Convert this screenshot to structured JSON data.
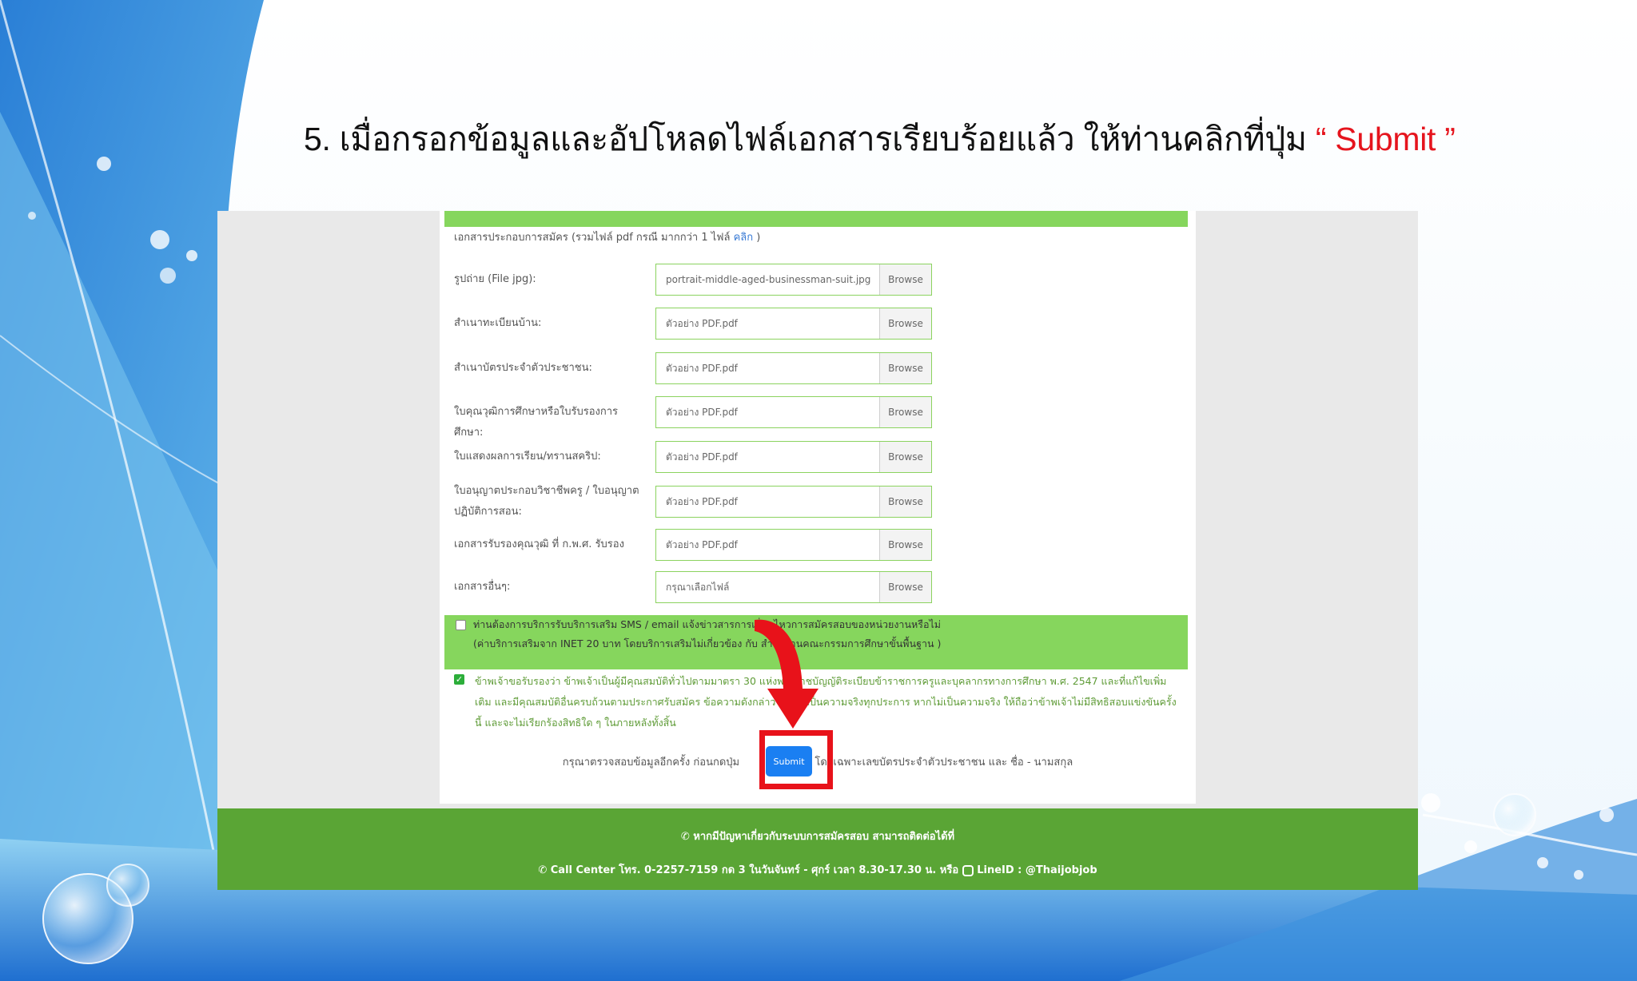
{
  "slide": {
    "title_prefix": "5. เมื่อกรอกข้อมูลและอัปโหลดไฟล์เอกสารเรียบร้อยแล้ว ให้ท่านคลิกที่ปุ่ม",
    "title_highlight": "“ Submit ”",
    "highlight_color": "#e5141d"
  },
  "form": {
    "intro_text": "เอกสารประกอบการสมัคร (รวมไฟล์ pdf กรณี มากกว่า 1 ไฟล์",
    "intro_link": "คลิก",
    "intro_close": ")",
    "browse_label": "Browse",
    "rows": [
      {
        "label": "รูปถ่าย (File jpg):",
        "file": "portrait-middle-aged-businessman-suit.jpg"
      },
      {
        "label": "สำเนาทะเบียนบ้าน:",
        "file": "ตัวอย่าง PDF.pdf"
      },
      {
        "label": "สำเนาบัตรประจำตัวประชาชน:",
        "file": "ตัวอย่าง PDF.pdf"
      },
      {
        "label": "ใบคุณวุฒิการศึกษาหรือใบรับรองการศึกษา:",
        "file": "ตัวอย่าง PDF.pdf"
      },
      {
        "label": "ใบแสดงผลการเรียน/ทรานสคริป:",
        "file": "ตัวอย่าง PDF.pdf"
      },
      {
        "label": "ใบอนุญาตประกอบวิชาชีพครู / ใบอนุญาตปฏิบัติการสอน:",
        "file": "ตัวอย่าง PDF.pdf"
      },
      {
        "label": "เอกสารรับรองคุณวุฒิ ที่ ก.พ.ศ. รับรอง",
        "file": "ตัวอย่าง PDF.pdf"
      },
      {
        "label": "เอกสารอื่นๆ:",
        "file": "กรุณาเลือกไฟล์"
      }
    ],
    "sms_line1": "ท่านต้องการบริการรับบริการเสริม SMS / email แจ้งข่าวสารการเลื่อนไหวการสมัครสอบของหน่วยงานหรือไม่",
    "sms_line2": "(ค่าบริการเสริมจาก INET 20 บาท โดยบริการเสริมไม่เกี่ยวข้อง กับ สำนักงานคณะกรรมการศึกษาขั้นพื้นฐาน )",
    "consent_text": "ข้าพเจ้าขอรับรองว่า ข้าพเจ้าเป็นผู้มีคุณสมบัติทั่วไปตามมาตรา 30 แห่งพระราชบัญญัติระเบียบข้าราชการครูและบุคลากรทางการศึกษา พ.ศ. 2547 และที่แก้ไขเพิ่มเติม และมีคุณสมบัติอื่นครบถ้วนตามประกาศรับสมัคร ข้อความดังกล่าวข้างต้นเป็นความจริงทุกประการ หากไม่เป็นความจริง ให้ถือว่าข้าพเจ้าไม่มีสิทธิสอบแข่งขันครั้งนี้ และจะไม่เรียกร้องสิทธิใด ๆ ในภายหลังทั้งสิ้น",
    "consent_checked": true,
    "sms_checked": false,
    "submit_note_before": "กรุณาตรวจสอบข้อมูลอีกครั้ง ก่อนกดปุ่ม",
    "submit_note_after": "โดยเฉพาะเลขบัตรประจำตัวประชาชน และ ชื่อ - นามสกุล",
    "submit_label": "Submit"
  },
  "footer": {
    "line1": "หากมีปัญหาเกี่ยวกับระบบการสมัครสอบ สามารถติดต่อได้ที่",
    "line2": "Call Center โทร. 0-2257-7159 กด 3 ในวันจันทร์ - ศุกร์ เวลา 8.30-17.30 น. หรือ",
    "line_id": "LineID : @Thaijobjob"
  },
  "colors": {
    "green_bar": "#86d65d",
    "footer_green": "#5aa535",
    "submit_blue": "#1a7ff2",
    "annotation_red": "#e8121a"
  },
  "icons": [
    "phone-icon",
    "line-icon",
    "arrow-down-icon",
    "checkbox-icon",
    "checkmark-icon"
  ]
}
